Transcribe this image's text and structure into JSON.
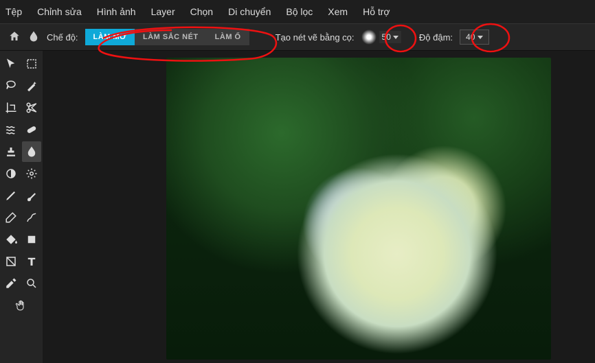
{
  "menu": {
    "file": "Tệp",
    "edit": "Chỉnh sửa",
    "image": "Hình ảnh",
    "layer": "Layer",
    "select": "Chọn",
    "move": "Di chuyển",
    "filter": "Bộ lọc",
    "view": "Xem",
    "help": "Hỗ trợ"
  },
  "optionbar": {
    "mode_label": "Chế độ:",
    "mode_blur": "LÀM MỜ",
    "mode_sharpen": "LÀM SẮC NÉT",
    "mode_smudge": "LÀM Ố",
    "brush_label": "Tạo nét vẽ bằng cọ:",
    "brush_size": "50",
    "intensity_label": "Độ đậm:",
    "intensity_value": "40"
  },
  "tools": {
    "pointer": "pointer",
    "marquee": "marquee",
    "lasso": "lasso",
    "wand": "wand",
    "crop": "crop",
    "cut": "cut",
    "liquify": "liquify",
    "heal": "heal",
    "stamp": "stamp",
    "drop": "drop",
    "dodge": "dodge",
    "gear": "gear",
    "pencil": "pencil",
    "brush": "brush",
    "eraser": "eraser",
    "pattern": "pattern",
    "fill": "fill",
    "shape": "shape",
    "gradient": "gradient",
    "text": "text",
    "eyedrop": "eyedrop",
    "zoom": "zoom",
    "hand": "hand"
  }
}
